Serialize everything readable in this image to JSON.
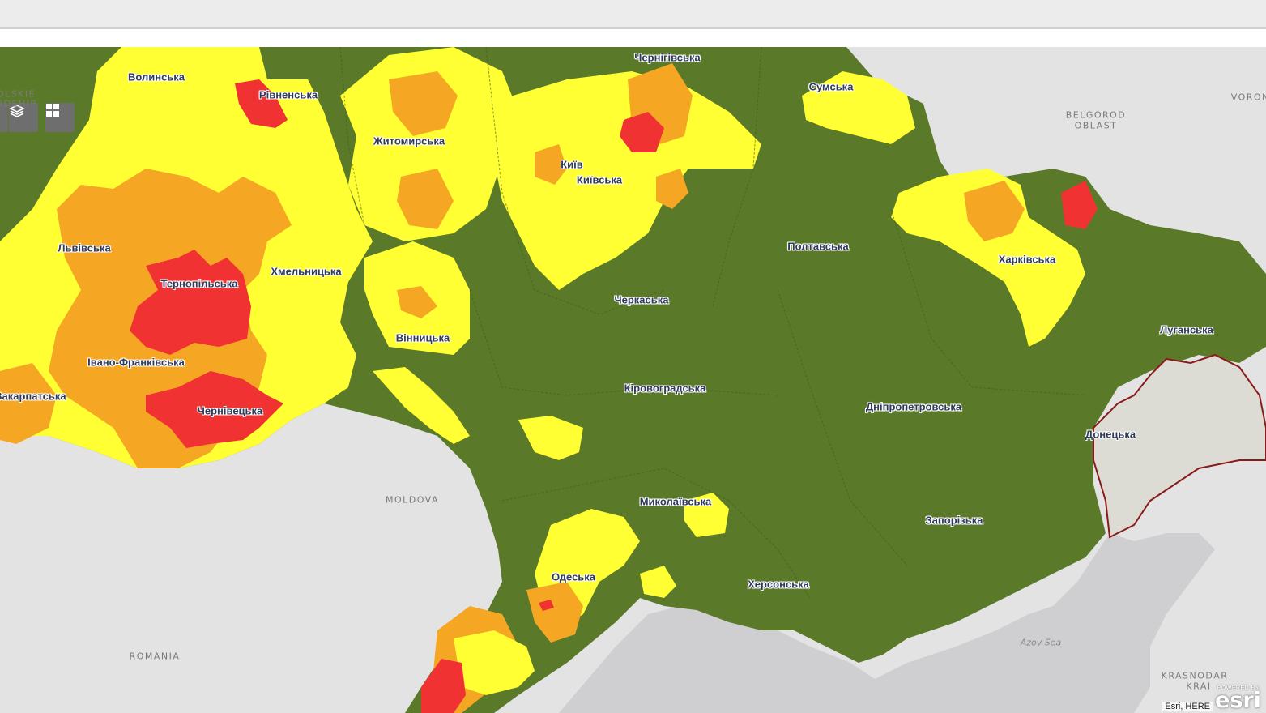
{
  "map": {
    "colors": {
      "green": "#5a7a29",
      "yellow": "#ffff33",
      "orange": "#f5a623",
      "red": "#f03232",
      "occupied": "#dcdcd5",
      "sea": "#cfcfd2",
      "land": "#e4e4e4",
      "border": "#8b1a1a"
    },
    "controls": {
      "layers_icon": "layers-icon",
      "basemap_icon": "grid-icon"
    },
    "regions": [
      {
        "id": "volynska",
        "label": "Волинська"
      },
      {
        "id": "rivnenska",
        "label": "Рівненська"
      },
      {
        "id": "chernihivska",
        "label": "Чернігівська"
      },
      {
        "id": "sumska",
        "label": "Сумська"
      },
      {
        "id": "zhytomyrska",
        "label": "Житомирська"
      },
      {
        "id": "kyiv",
        "label": "Київ"
      },
      {
        "id": "kyivska",
        "label": "Київська"
      },
      {
        "id": "lvivska",
        "label": "Львівська"
      },
      {
        "id": "khmelnytska",
        "label": "Хмельницька"
      },
      {
        "id": "ternopilska",
        "label": "Тернопільська"
      },
      {
        "id": "poltavska",
        "label": "Полтавська"
      },
      {
        "id": "kharkivska",
        "label": "Харківська"
      },
      {
        "id": "cherkaska",
        "label": "Черкаська"
      },
      {
        "id": "vinnytska",
        "label": "Вінницька"
      },
      {
        "id": "luhanska",
        "label": "Луганська"
      },
      {
        "id": "ivano-frankivska",
        "label": "Івано-Франківська"
      },
      {
        "id": "kirovohradska",
        "label": "Кіровоградська"
      },
      {
        "id": "zakarpatska",
        "label": "Закарпатська"
      },
      {
        "id": "dnipropetrovska",
        "label": "Дніпропетровська"
      },
      {
        "id": "chernivetska",
        "label": "Чернівецька"
      },
      {
        "id": "donetska",
        "label": "Донецька"
      },
      {
        "id": "mykolaivska",
        "label": "Миколаївська"
      },
      {
        "id": "zaporizka",
        "label": "Запорізька"
      },
      {
        "id": "odeska",
        "label": "Одеська"
      },
      {
        "id": "khersonska",
        "label": "Херсонська"
      }
    ],
    "basemap_labels": {
      "poland_1": "OLSKIE",
      "poland_2": "ODSHIP",
      "belgorod_1": "BELGOROD",
      "belgorod_2": "OBLAST",
      "moldova": "MOLDOVA",
      "romania": "ROMANIA",
      "azov": "Azov Sea",
      "krasnodar_1": "KRASNODAR",
      "krasnodar_2": "KRAI",
      "voronezh": "VORONE"
    },
    "attribution": "Esri, HERE",
    "logo": {
      "powered": "POWERED BY",
      "word": "esri"
    }
  }
}
